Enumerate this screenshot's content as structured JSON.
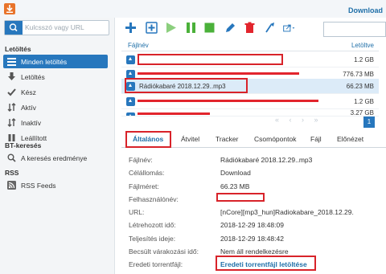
{
  "app": {
    "title": "Download"
  },
  "search": {
    "placeholder": "Kulcsszó vagy URL"
  },
  "sidebar": {
    "sections": [
      {
        "label": "Letöltés"
      },
      {
        "label": "BT-keresés"
      },
      {
        "label": "RSS"
      }
    ],
    "items": [
      {
        "label": "Minden letöltés",
        "icon": "list-icon"
      },
      {
        "label": "Letöltés",
        "icon": "arrow-down-icon"
      },
      {
        "label": "Kész",
        "icon": "check-icon"
      },
      {
        "label": "Aktív",
        "icon": "active-arrows-icon"
      },
      {
        "label": "Inaktív",
        "icon": "inactive-arrows-icon"
      },
      {
        "label": "Leállított",
        "icon": "pause-icon"
      },
      {
        "label": "A keresés eredménye",
        "icon": "search-icon"
      },
      {
        "label": "RSS Feeds",
        "icon": "rss-icon"
      }
    ]
  },
  "list": {
    "col_name": "Fájlnév",
    "col_downloaded": "Letöltve",
    "rows": [
      {
        "name": "",
        "size": "1.2 GB"
      },
      {
        "name": "",
        "size": "776.73 MB"
      },
      {
        "name": "Rádiókabaré 2018.12.29..mp3",
        "size": "66.23 MB"
      },
      {
        "name": "",
        "size": "1.2 GB"
      },
      {
        "name": "",
        "size": "3.27 GB"
      }
    ],
    "page": "1"
  },
  "tabs": [
    "Általános",
    "Átvitel",
    "Tracker",
    "Csomópontok",
    "Fájl",
    "Előnézet"
  ],
  "details": {
    "filename_label": "Fájlnév:",
    "filename": "Rádiókabaré 2018.12.29..mp3",
    "dest_label": "Célállomás:",
    "dest": "Download",
    "size_label": "Fájlméret:",
    "size": "66.23 MB",
    "user_label": "Felhasználónév:",
    "url_label": "URL:",
    "url": "[nCore][mp3_hun]Radiokabare_2018.12.29.",
    "created_label": "Létrehozott idő:",
    "created": "2018-12-29 18:48:09",
    "completed_label": "Teljesítés ideje:",
    "completed": "2018-12-29 18:48:42",
    "eta_label": "Becsült várakozási idő:",
    "eta": "Nem áll rendelkezésre",
    "torrent_label": "Eredeti torrentfájl:",
    "torrent_link": "Eredeti torrentfájl letöltése"
  },
  "colors": {
    "accent": "#2777bd",
    "redaction": "#e2252d"
  }
}
